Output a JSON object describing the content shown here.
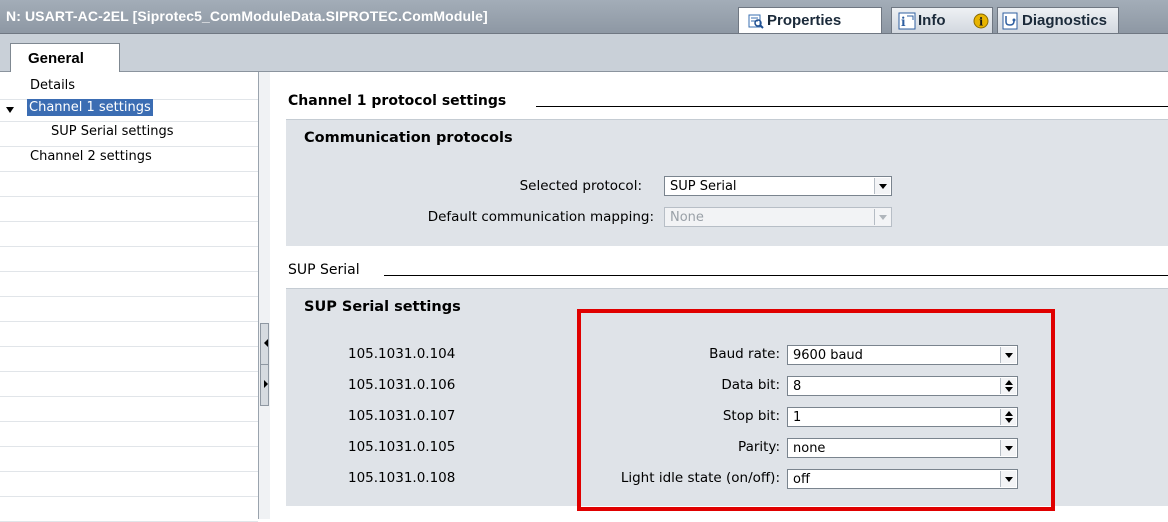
{
  "window": {
    "title": "N: USART-AC-2EL [Siprotec5_ComModuleData.SIPROTEC.ComModule]",
    "tabs": [
      {
        "label": "Properties",
        "icon": "properties-icon",
        "active": true
      },
      {
        "label": "Info",
        "icon": "info-icon",
        "active": false
      },
      {
        "label": "Diagnostics",
        "icon": "diagnostics-icon",
        "active": false
      }
    ]
  },
  "header": {
    "general_tab": "General"
  },
  "nav": {
    "items": [
      {
        "label": "Details"
      },
      {
        "label": "Channel 1 settings",
        "selected": true,
        "expanded": true
      },
      {
        "label": "SUP Serial settings"
      },
      {
        "label": "Channel 2 settings"
      }
    ]
  },
  "main": {
    "channel_section": "Channel 1 protocol settings",
    "comm_panel": {
      "title": "Communication protocols",
      "selected_protocol_label": "Selected protocol:",
      "selected_protocol_value": "SUP Serial",
      "default_mapping_label": "Default communication mapping:",
      "default_mapping_value": "None"
    },
    "sup_section": "SUP Serial",
    "sup_panel": {
      "title": "SUP Serial settings",
      "rows": [
        {
          "id": "105.1031.0.104",
          "label": "Baud rate:",
          "value": "9600 baud",
          "control": "dropdown"
        },
        {
          "id": "105.1031.0.106",
          "label": "Data bit:",
          "value": "8",
          "control": "spinner"
        },
        {
          "id": "105.1031.0.107",
          "label": "Stop bit:",
          "value": "1",
          "control": "spinner"
        },
        {
          "id": "105.1031.0.105",
          "label": "Parity:",
          "value": "none",
          "control": "dropdown"
        },
        {
          "id": "105.1031.0.108",
          "label": "Light idle state (on/off):",
          "value": "off",
          "control": "dropdown"
        }
      ]
    }
  },
  "colors": {
    "selection": "#3b6db3",
    "highlight_box": "#e00000",
    "panel_bg": "#dfe3e8",
    "titlebar": "#95a0ab"
  }
}
